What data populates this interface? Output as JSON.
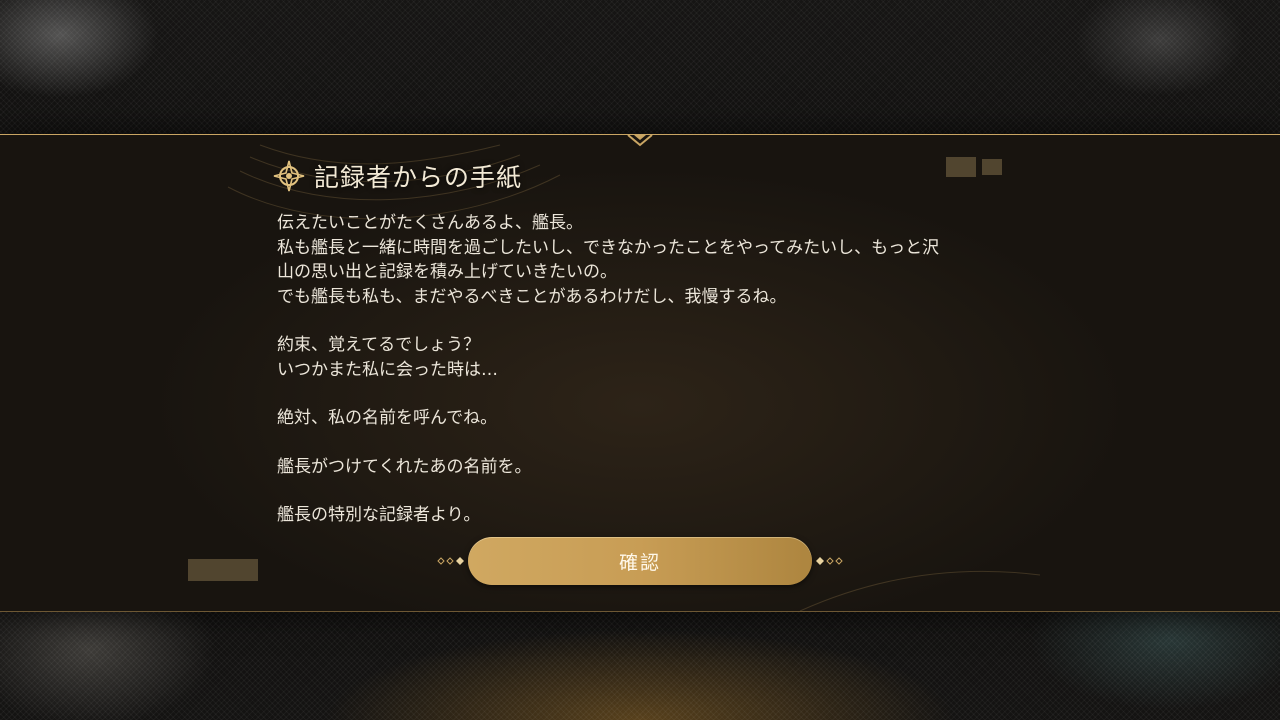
{
  "dialog": {
    "title": "記録者からの手紙",
    "paragraphs": [
      [
        "伝えたいことがたくさんあるよ、艦長。",
        "私も艦長と一緒に時間を過ごしたいし、できなかったことをやってみたいし、もっと沢",
        "山の思い出と記録を積み上げていきたいの。",
        "でも艦長も私も、まだやるべきことがあるわけだし、我慢するね。"
      ],
      [
        "約束、覚えてるでしょう？",
        "いつかまた私に会った時は…"
      ],
      [
        "絶対、私の名前を呼んでね。"
      ],
      [
        "艦長がつけてくれたあの名前を。"
      ],
      [
        "艦長の特別な記録者より。"
      ]
    ],
    "confirm_label": "確認"
  },
  "colors": {
    "accent_gold": "#c9a563",
    "button_gradient_start": "#d0a861",
    "button_gradient_end": "#ad853f",
    "text": "#ece6da"
  },
  "icons": {
    "title_icon": "compass-star-icon",
    "button_ornament": "diamond-dots-ornament"
  }
}
